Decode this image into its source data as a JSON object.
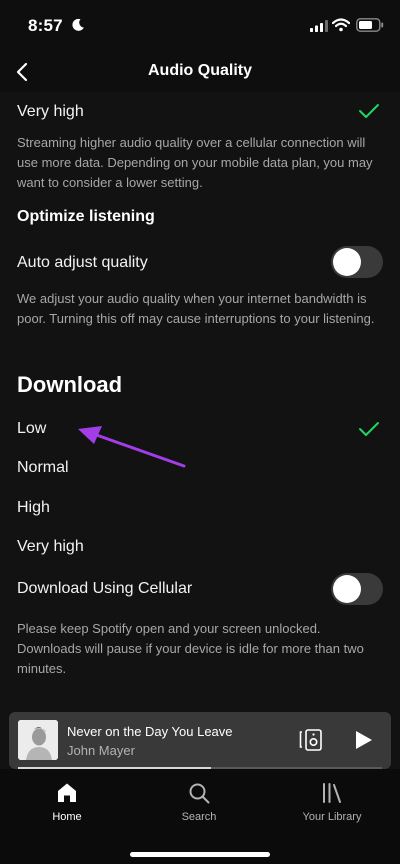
{
  "status_bar": {
    "time": "8:57"
  },
  "header": {
    "title": "Audio Quality",
    "back_icon": "chevron-left-icon"
  },
  "streaming": {
    "selected_option": "Very high",
    "cellular_note": "Streaming higher audio quality over a cellular connection will use more data. Depending on your mobile data plan, you may want to consider a lower setting."
  },
  "optimize": {
    "title": "Optimize listening",
    "auto_adjust_label": "Auto adjust quality",
    "auto_adjust_on": false,
    "auto_adjust_note": "We adjust your audio quality when your internet bandwidth is poor. Turning this off may cause interruptions to your listening."
  },
  "download": {
    "title": "Download",
    "options": [
      {
        "label": "Low",
        "selected": true
      },
      {
        "label": "Normal",
        "selected": false
      },
      {
        "label": "High",
        "selected": false
      },
      {
        "label": "Very high",
        "selected": false
      }
    ],
    "cellular_label": "Download Using Cellular",
    "cellular_on": false,
    "cellular_note": "Please keep Spotify open and your screen unlocked. Downloads will pause if your device is idle for more than two minutes."
  },
  "now_playing": {
    "title": "Never on the Day You Leave",
    "artist": "John Mayer",
    "progress": 0.53
  },
  "tabs": [
    {
      "label": "Home",
      "icon": "home-icon",
      "active": true
    },
    {
      "label": "Search",
      "icon": "search-icon",
      "active": false
    },
    {
      "label": "Your Library",
      "icon": "library-icon",
      "active": false
    }
  ],
  "colors": {
    "accent": "#1ed760",
    "annotation_arrow": "#a33de8",
    "background": "#121212"
  }
}
